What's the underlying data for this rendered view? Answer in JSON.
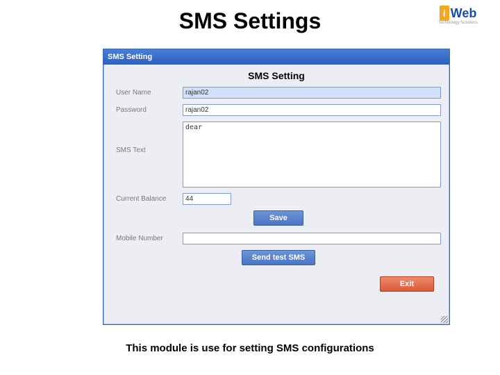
{
  "slide": {
    "title": "SMS Settings",
    "caption": "This module is use for setting SMS configurations"
  },
  "logo": {
    "top_text": "",
    "i": "i",
    "web": "Web",
    "sub": "Technology Solutions"
  },
  "window": {
    "titlebar": "SMS Setting",
    "inner_title": "SMS Setting",
    "labels": {
      "username": "User Name",
      "password": "Password",
      "sms_text": "SMS Text",
      "balance": "Current Balance",
      "mobile": "Mobile Number"
    },
    "values": {
      "username": "rajan02",
      "password": "rajan02",
      "sms_text": "dear",
      "balance": "44",
      "mobile": ""
    },
    "buttons": {
      "save": "Save",
      "send_test": "Send test SMS",
      "exit": "Exit"
    }
  }
}
